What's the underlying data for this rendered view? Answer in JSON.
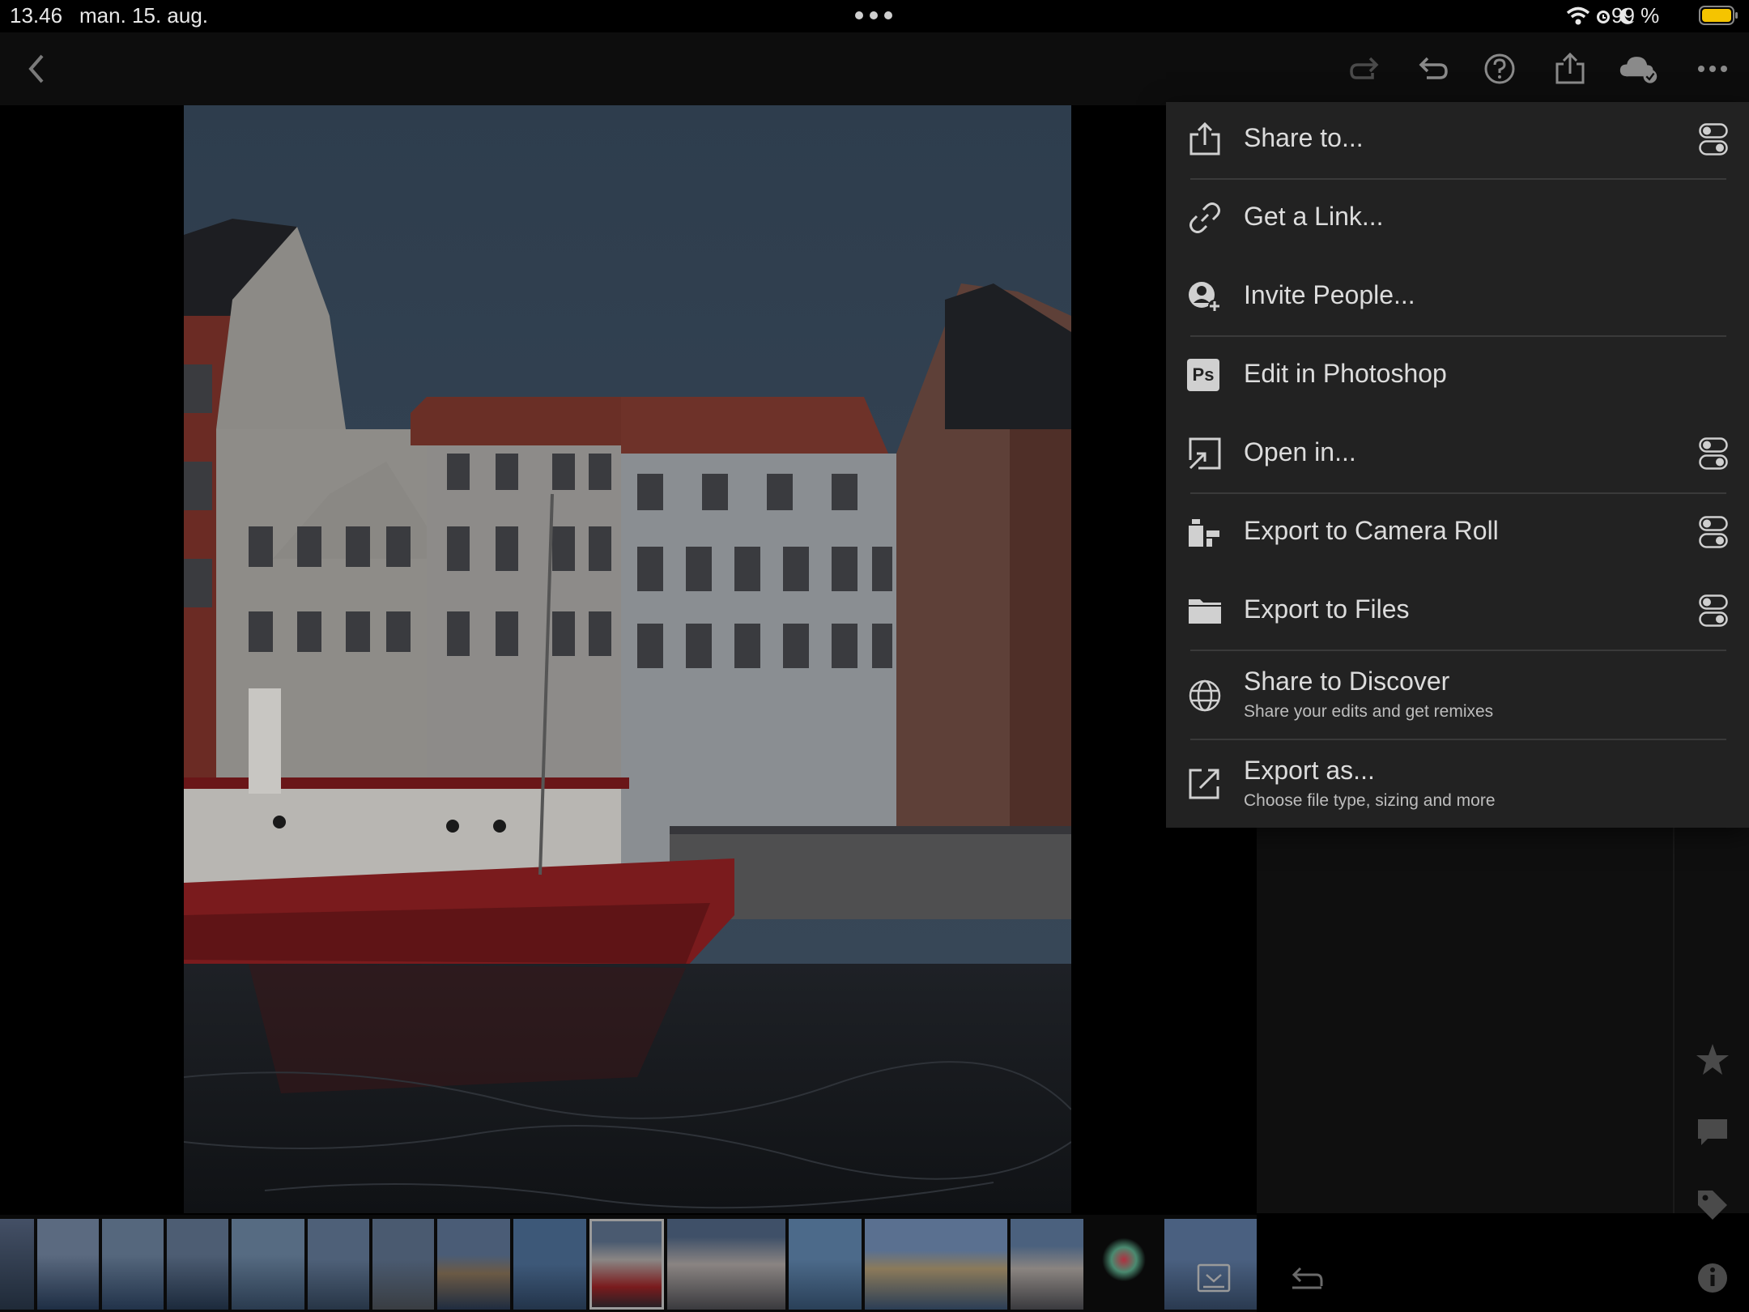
{
  "status_bar": {
    "time": "13.46",
    "date": "man. 15. aug.",
    "battery": "99 %"
  },
  "toolbar": {
    "icons": [
      "back-chevron-icon",
      "redo-icon",
      "undo-icon",
      "help-icon",
      "share-icon",
      "cloud-synced-icon",
      "more-icon"
    ]
  },
  "menu": {
    "items": [
      {
        "label": "Share to...",
        "icon": "share-icon",
        "settings": true
      },
      {
        "label": "Get a Link...",
        "icon": "link-icon",
        "settings": false
      },
      {
        "label": "Invite People...",
        "icon": "invite-person-icon",
        "settings": false
      },
      {
        "label": "Edit in Photoshop",
        "icon": "photoshop-icon",
        "settings": false
      },
      {
        "label": "Open in...",
        "icon": "open-in-icon",
        "settings": true
      },
      {
        "label": "Export to Camera Roll",
        "icon": "camera-roll-icon",
        "settings": true
      },
      {
        "label": "Export to Files",
        "icon": "folder-icon",
        "settings": true
      },
      {
        "label": "Share to Discover",
        "sub": "Share your edits and get remixes",
        "icon": "globe-icon",
        "settings": false
      },
      {
        "label": "Export as...",
        "sub": "Choose file type, sizing and more",
        "icon": "export-icon",
        "settings": false
      }
    ],
    "ps_badge": "Ps"
  },
  "side_icons": [
    "star-icon",
    "comment-icon",
    "tag-icon",
    "info-icon"
  ],
  "colors": {
    "menu_bg": "#222222",
    "battery": "#f5c400",
    "boat_red": "#8e1b1e"
  }
}
